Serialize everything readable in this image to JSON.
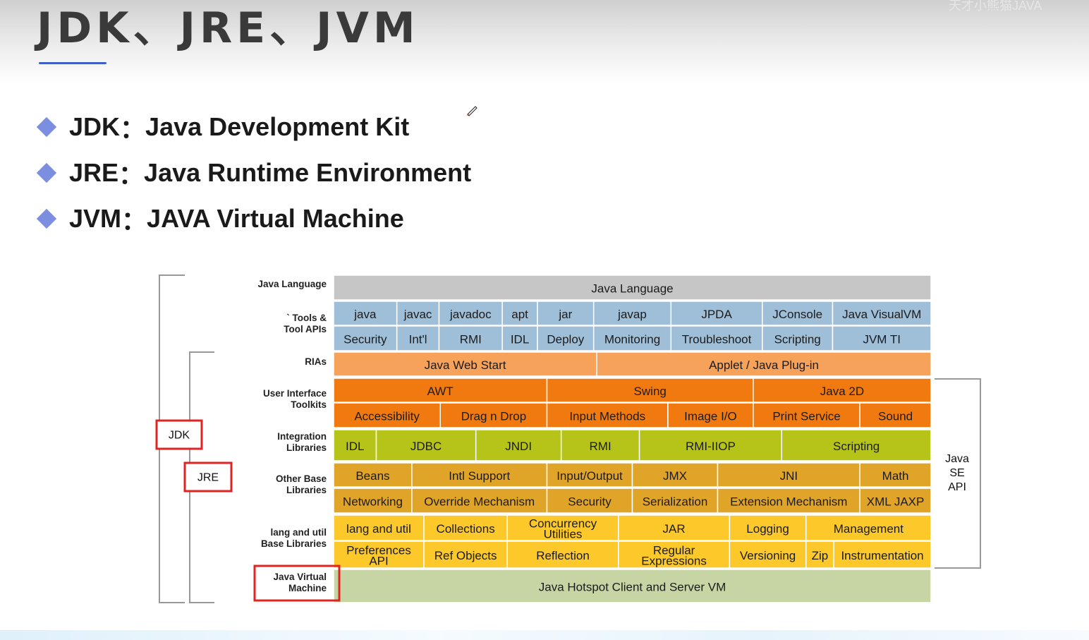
{
  "title": "JDK、JRE、JVM",
  "watermark": "天才小熊猫JAVA",
  "bullets": [
    {
      "term": "JDK",
      "separator": "：",
      "meaning": "Java Development Kit"
    },
    {
      "term": "JRE",
      "separator": "：",
      "meaning": "Java Runtime Environment"
    },
    {
      "term": "JVM",
      "separator": "：",
      "meaning": "JAVA Virtual Machine"
    }
  ],
  "diagram": {
    "colors": {
      "gray": "#c6c6c6",
      "blue": "#9fbfd9",
      "light_orange": "#f6a25a",
      "dark_orange": "#f07a10",
      "green": "#b6c41a",
      "gold": "#e0a428",
      "yellow": "#fcc82a",
      "sage": "#c7d5a4",
      "red_box": "#e02424",
      "bracket": "#999999"
    },
    "row_labels": [
      {
        "lines": [
          "Java Language"
        ]
      },
      {
        "lines": [
          "` Tools &",
          "Tool APIs"
        ]
      },
      {
        "lines": [
          "RIAs"
        ]
      },
      {
        "lines": [
          "User Interface",
          "Toolkits"
        ]
      },
      {
        "lines": [
          "Integration",
          "Libraries"
        ]
      },
      {
        "lines": [
          "Other Base",
          "Libraries"
        ]
      },
      {
        "lines": [
          "lang and util",
          "Base Libraries"
        ]
      },
      {
        "lines": [
          "Java Virtual",
          "Machine"
        ],
        "highlight": true
      }
    ],
    "rows": [
      {
        "color": "gray",
        "cells": [
          [
            "Java Language",
            1
          ]
        ]
      },
      {
        "color": "blue",
        "cells": [
          [
            "java",
            9
          ],
          [
            "javac",
            6
          ],
          [
            "javadoc",
            9
          ],
          [
            "apt",
            5
          ],
          [
            "jar",
            8
          ],
          [
            "javap",
            11
          ],
          [
            "JPDA",
            13
          ],
          [
            "JConsole",
            10
          ],
          [
            "Java VisualVM",
            14
          ]
        ]
      },
      {
        "color": "blue",
        "cells": [
          [
            "Security",
            9
          ],
          [
            "Int'l",
            6
          ],
          [
            "RMI",
            9
          ],
          [
            "IDL",
            5
          ],
          [
            "Deploy",
            8
          ],
          [
            "Monitoring",
            11
          ],
          [
            "Troubleshoot",
            13
          ],
          [
            "Scripting",
            10
          ],
          [
            "JVM TI",
            14
          ]
        ]
      },
      {
        "color": "light_orange",
        "cells": [
          [
            "Java Web Start",
            37
          ],
          [
            "Applet / Java Plug-in",
            47
          ]
        ]
      },
      {
        "color": "dark_orange",
        "cells": [
          [
            "AWT",
            30
          ],
          [
            "Swing",
            29
          ],
          [
            "Java 2D",
            25
          ]
        ]
      },
      {
        "color": "dark_orange",
        "cells": [
          [
            "Accessibility",
            15
          ],
          [
            "Drag n Drop",
            15
          ],
          [
            "Input Methods",
            17
          ],
          [
            "Image I/O",
            12
          ],
          [
            "Print Service",
            15
          ],
          [
            "Sound",
            10
          ]
        ]
      },
      {
        "color": "green",
        "cells": [
          [
            "IDL",
            6
          ],
          [
            "JDBC",
            14
          ],
          [
            "JNDI",
            12
          ],
          [
            "RMI",
            11
          ],
          [
            "RMI-IIOP",
            20
          ],
          [
            "Scripting",
            21
          ]
        ]
      },
      {
        "color": "gold",
        "cells": [
          [
            "Beans",
            11
          ],
          [
            "Intl Support",
            19
          ],
          [
            "Input/Output",
            12
          ],
          [
            "JMX",
            12
          ],
          [
            "JNI",
            20
          ],
          [
            "Math",
            10
          ]
        ]
      },
      {
        "color": "gold",
        "cells": [
          [
            "Networking",
            11
          ],
          [
            "Override Mechanism",
            19
          ],
          [
            "Security",
            12
          ],
          [
            "Serialization",
            12
          ],
          [
            "Extension Mechanism",
            20
          ],
          [
            "XML JAXP",
            10
          ]
        ]
      },
      {
        "color": "yellow",
        "cells": [
          [
            "lang and util",
            13
          ],
          [
            "Collections",
            12
          ],
          [
            "Concurrency|Utilities",
            16
          ],
          [
            "JAR",
            16
          ],
          [
            "Logging",
            11
          ],
          [
            "Management",
            18
          ]
        ]
      },
      {
        "color": "yellow",
        "cells": [
          [
            "Preferences|API",
            13
          ],
          [
            "Ref Objects",
            12
          ],
          [
            "Reflection",
            16
          ],
          [
            "Regular|Expressions",
            16
          ],
          [
            "Versioning",
            11
          ],
          [
            "Zip",
            4
          ],
          [
            "Instrumentation",
            14
          ]
        ]
      },
      {
        "color": "sage",
        "cells": [
          [
            "Java Hotspot Client and Server VM",
            1
          ]
        ]
      }
    ],
    "side_labels": {
      "jdk": "JDK",
      "jre": "JRE",
      "java_se_api": [
        "Java",
        "SE",
        "API"
      ]
    }
  }
}
